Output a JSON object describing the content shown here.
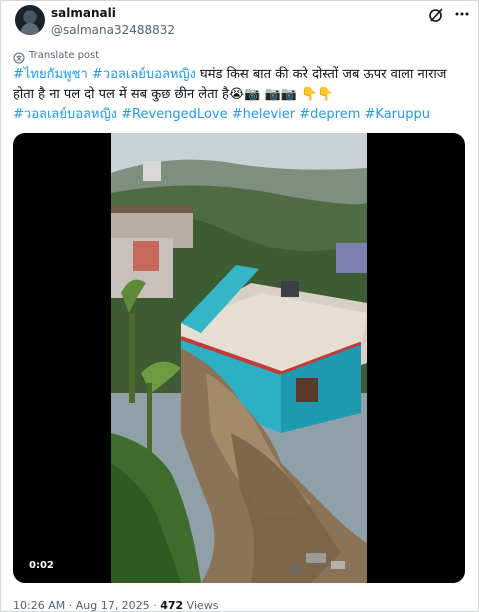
{
  "author": {
    "name": "salmanali",
    "handle": "@salmana32488832"
  },
  "actions": {
    "grok_icon": "grok-icon",
    "more_icon": "more-icon"
  },
  "translate": {
    "label": "Translate post"
  },
  "tweet": {
    "hashtag1": "#ไทยกัมพูชา",
    "hashtag2": "#วอลเลย์บอลหญิง",
    "text_main": " घमंड किस बात की करे दोस्तों  जब ऊपर वाला नाराज होता है ना पल दो पल में सब कुछ छीन लेता है",
    "emojis": "😭📷 📷📷 👇👇",
    "hashtag3": "#วอลเลย์บอลหญิง",
    "hashtag4": "#RevengedLove",
    "hashtag5": "#helevier",
    "hashtag6": "#deprem",
    "hashtag7": "#Karuppu"
  },
  "video": {
    "duration": "0:02"
  },
  "meta": {
    "time": "10:26 AM",
    "separator": "·",
    "date": "Aug 17, 2025",
    "views_count": "472",
    "views_label": "Views"
  },
  "colors": {
    "link": "#1d9bf0",
    "secondary_text": "#536471",
    "primary_text": "#0f1419"
  }
}
